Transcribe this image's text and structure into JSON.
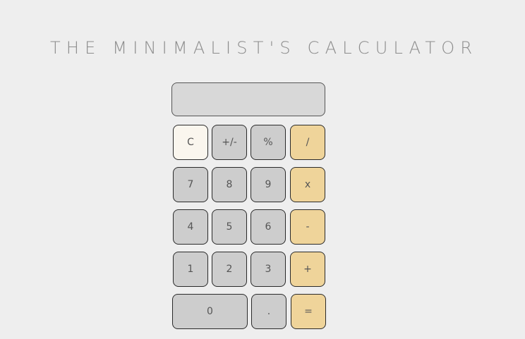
{
  "title": "THE MINIMALIST'S CALCULATOR",
  "display": {
    "value": ""
  },
  "keys": {
    "clear": "C",
    "sign": "+/-",
    "percent": "%",
    "divide": "/",
    "seven": "7",
    "eight": "8",
    "nine": "9",
    "multiply": "x",
    "four": "4",
    "five": "5",
    "six": "6",
    "subtract": "-",
    "one": "1",
    "two": "2",
    "three": "3",
    "add": "+",
    "zero": "0",
    "decimal": ".",
    "equals": "="
  },
  "colors": {
    "background": "#eeeeee",
    "display": "#d8d8d8",
    "digit_key": "#cdcdcd",
    "clear_key": "#faf6ee",
    "operator_key": "#efd49a"
  }
}
